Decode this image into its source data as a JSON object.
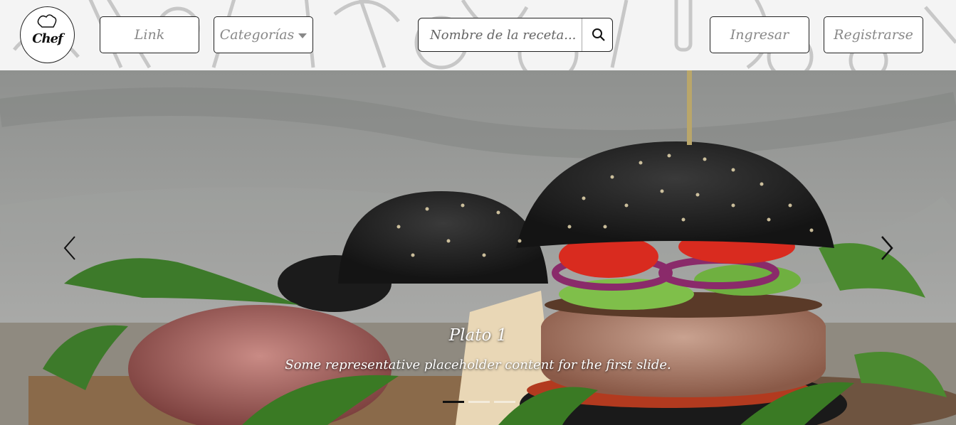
{
  "brand": {
    "logo_text": "Chef"
  },
  "nav": {
    "link_label": "Link",
    "categories_label": "Categorías",
    "login_label": "Ingresar",
    "register_label": "Registrarse"
  },
  "search": {
    "placeholder": "Nombre de la receta..."
  },
  "carousel": {
    "slides": [
      {
        "title": "Plato 1",
        "text": "Some representative placeholder content for the first slide."
      }
    ],
    "indicator_count": 3,
    "active_index": 0
  },
  "icons": {
    "prev": "chevron-left-icon",
    "next": "chevron-right-icon",
    "search": "search-icon",
    "logo": "chef-hat-icon"
  }
}
